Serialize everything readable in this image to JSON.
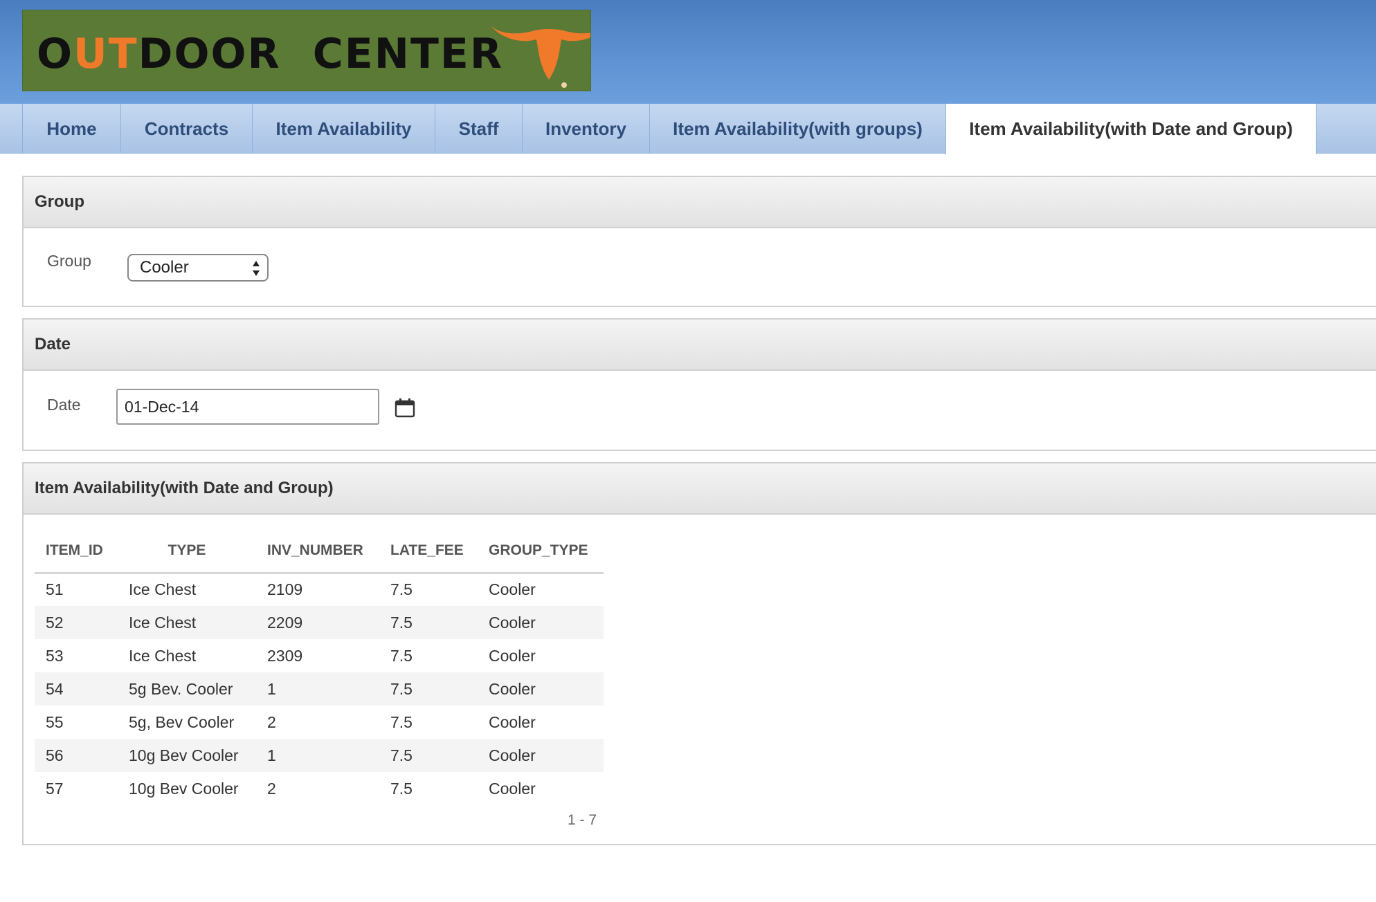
{
  "header": {
    "logo": {
      "part1": "O",
      "accent": "UT",
      "part2": "DOOR",
      "part3": "CENTER",
      "horn_color": "#f07a2a",
      "bg_color": "#5b7a36"
    }
  },
  "tabs": [
    {
      "label": "Home",
      "active": false
    },
    {
      "label": "Contracts",
      "active": false
    },
    {
      "label": "Item Availability",
      "active": false
    },
    {
      "label": "Staff",
      "active": false
    },
    {
      "label": "Inventory",
      "active": false
    },
    {
      "label": "Item Availability(with groups)",
      "active": false
    },
    {
      "label": "Item Availability(with Date and Group)",
      "active": true
    }
  ],
  "group_panel": {
    "title": "Group",
    "label": "Group",
    "selected": "Cooler"
  },
  "date_panel": {
    "title": "Date",
    "label": "Date",
    "value": "01-Dec-14",
    "icon": "calendar-icon"
  },
  "report": {
    "title": "Item Availability(with Date and Group)",
    "columns": [
      "ITEM_ID",
      "TYPE",
      "INV_NUMBER",
      "LATE_FEE",
      "GROUP_TYPE"
    ],
    "rows": [
      [
        "51",
        "Ice Chest",
        "2109",
        "7.5",
        "Cooler"
      ],
      [
        "52",
        "Ice Chest",
        "2209",
        "7.5",
        "Cooler"
      ],
      [
        "53",
        "Ice Chest",
        "2309",
        "7.5",
        "Cooler"
      ],
      [
        "54",
        "5g Bev. Cooler",
        "1",
        "7.5",
        "Cooler"
      ],
      [
        "55",
        "5g, Bev Cooler",
        "2",
        "7.5",
        "Cooler"
      ],
      [
        "56",
        "10g Bev Cooler",
        "1",
        "7.5",
        "Cooler"
      ],
      [
        "57",
        "10g Bev Cooler",
        "2",
        "7.5",
        "Cooler"
      ]
    ],
    "pagination": "1 - 7"
  }
}
